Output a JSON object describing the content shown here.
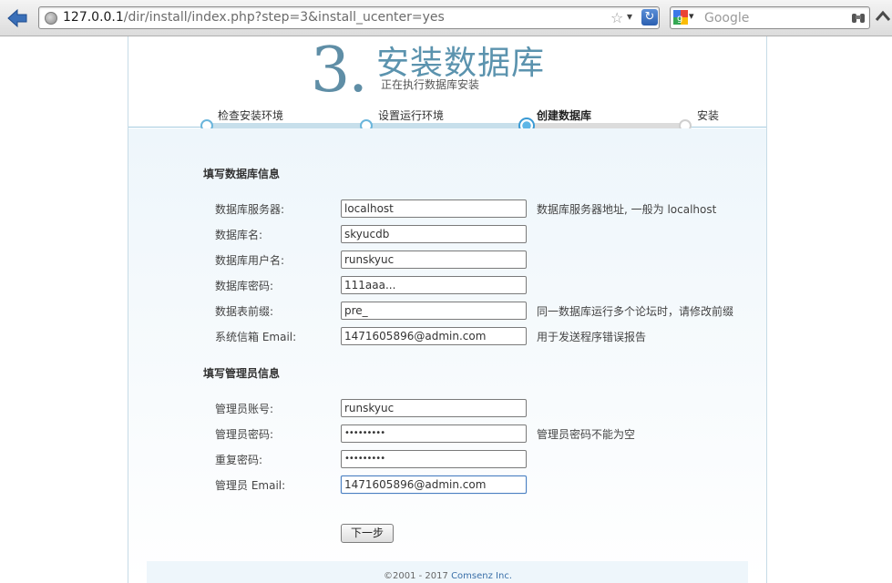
{
  "browser": {
    "url_host": "127.0.0.1",
    "url_path": "/dir/install/index.php?step=3&install_ucenter=yes",
    "search_placeholder": "Google"
  },
  "header": {
    "step_number": "3.",
    "title": "安装数据库",
    "subtitle": "正在执行数据库安装"
  },
  "steps": [
    {
      "label": "检查安装环境",
      "state": "done"
    },
    {
      "label": "设置运行环境",
      "state": "done"
    },
    {
      "label": "创建数据库",
      "state": "current"
    },
    {
      "label": "安装",
      "state": "todo"
    }
  ],
  "db_section": {
    "title": "填写数据库信息",
    "fields": [
      {
        "label": "数据库服务器:",
        "value": "localhost",
        "hint": "数据库服务器地址, 一般为 localhost"
      },
      {
        "label": "数据库名:",
        "value": "skyucdb",
        "hint": ""
      },
      {
        "label": "数据库用户名:",
        "value": "runskyuc",
        "hint": ""
      },
      {
        "label": "数据库密码:",
        "value": "111aaa...",
        "hint": ""
      },
      {
        "label": "数据表前缀:",
        "value": "pre_",
        "hint": "同一数据库运行多个论坛时，请修改前缀"
      },
      {
        "label": "系统信箱 Email:",
        "value": "1471605896@admin.com",
        "hint": "用于发送程序错误报告"
      }
    ]
  },
  "admin_section": {
    "title": "填写管理员信息",
    "fields": [
      {
        "label": "管理员账号:",
        "value": "runskyuc",
        "hint": ""
      },
      {
        "label": "管理员密码:",
        "value": "•••••••••",
        "hint": "管理员密码不能为空"
      },
      {
        "label": "重复密码:",
        "value": "•••••••••",
        "hint": ""
      },
      {
        "label": "管理员 Email:",
        "value": "1471605896@admin.com",
        "hint": ""
      }
    ]
  },
  "next_button": "下一步",
  "footer": {
    "copyright": "©2001 - 2017",
    "company": "Comsenz Inc."
  },
  "colors": {
    "accent": "#5b93ae",
    "progress": "#3a9ad4"
  }
}
